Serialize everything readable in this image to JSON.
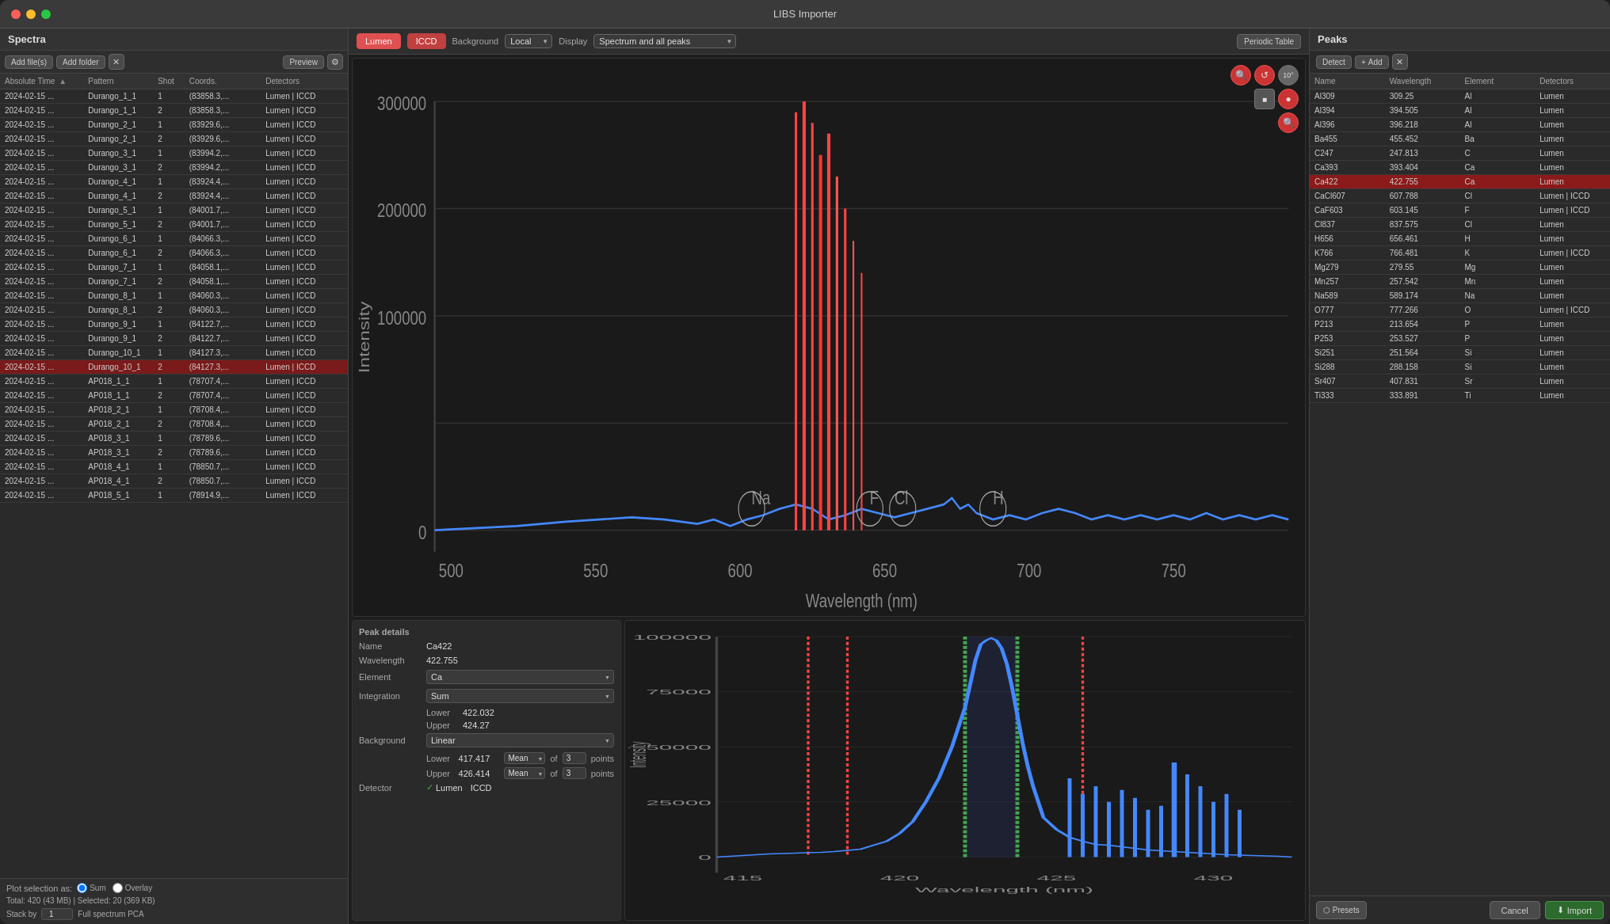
{
  "window": {
    "title": "LIBS Importer",
    "traffic_lights": [
      "close",
      "minimize",
      "maximize"
    ]
  },
  "spectra_panel": {
    "title": "Spectra",
    "toolbar": {
      "add_files": "Add file(s)",
      "add_folder": "Add folder",
      "preview": "Preview"
    },
    "columns": [
      {
        "key": "time",
        "label": "Absolute Time",
        "width": "24%"
      },
      {
        "key": "pattern",
        "label": "Pattern",
        "width": "20%"
      },
      {
        "key": "shot",
        "label": "Shot",
        "width": "10%"
      },
      {
        "key": "coords",
        "label": "Coords.",
        "width": "22%"
      },
      {
        "key": "detectors",
        "label": "Detectors",
        "width": "24%"
      }
    ],
    "rows": [
      {
        "time": "2024-02-15 ...",
        "pattern": "Durango_1_1",
        "shot": "1",
        "coords": "(83858.3,...",
        "detectors": "Lumen | ICCD",
        "selected": false
      },
      {
        "time": "2024-02-15 ...",
        "pattern": "Durango_1_1",
        "shot": "2",
        "coords": "(83858.3,...",
        "detectors": "Lumen | ICCD",
        "selected": false
      },
      {
        "time": "2024-02-15 ...",
        "pattern": "Durango_2_1",
        "shot": "1",
        "coords": "(83929.6,...",
        "detectors": "Lumen | ICCD",
        "selected": false
      },
      {
        "time": "2024-02-15 ...",
        "pattern": "Durango_2_1",
        "shot": "2",
        "coords": "(83929.6,...",
        "detectors": "Lumen | ICCD",
        "selected": false
      },
      {
        "time": "2024-02-15 ...",
        "pattern": "Durango_3_1",
        "shot": "1",
        "coords": "(83994.2,...",
        "detectors": "Lumen | ICCD",
        "selected": false
      },
      {
        "time": "2024-02-15 ...",
        "pattern": "Durango_3_1",
        "shot": "2",
        "coords": "(83994.2,...",
        "detectors": "Lumen | ICCD",
        "selected": false
      },
      {
        "time": "2024-02-15 ...",
        "pattern": "Durango_4_1",
        "shot": "1",
        "coords": "(83924.4,...",
        "detectors": "Lumen | ICCD",
        "selected": false
      },
      {
        "time": "2024-02-15 ...",
        "pattern": "Durango_4_1",
        "shot": "2",
        "coords": "(83924.4,...",
        "detectors": "Lumen | ICCD",
        "selected": false
      },
      {
        "time": "2024-02-15 ...",
        "pattern": "Durango_5_1",
        "shot": "1",
        "coords": "(84001.7,...",
        "detectors": "Lumen | ICCD",
        "selected": false
      },
      {
        "time": "2024-02-15 ...",
        "pattern": "Durango_5_1",
        "shot": "2",
        "coords": "(84001.7,...",
        "detectors": "Lumen | ICCD",
        "selected": false
      },
      {
        "time": "2024-02-15 ...",
        "pattern": "Durango_6_1",
        "shot": "1",
        "coords": "(84066.3,...",
        "detectors": "Lumen | ICCD",
        "selected": false
      },
      {
        "time": "2024-02-15 ...",
        "pattern": "Durango_6_1",
        "shot": "2",
        "coords": "(84066.3,...",
        "detectors": "Lumen | ICCD",
        "selected": false
      },
      {
        "time": "2024-02-15 ...",
        "pattern": "Durango_7_1",
        "shot": "1",
        "coords": "(84058.1,...",
        "detectors": "Lumen | ICCD",
        "selected": false
      },
      {
        "time": "2024-02-15 ...",
        "pattern": "Durango_7_1",
        "shot": "2",
        "coords": "(84058.1,...",
        "detectors": "Lumen | ICCD",
        "selected": false
      },
      {
        "time": "2024-02-15 ...",
        "pattern": "Durango_8_1",
        "shot": "1",
        "coords": "(84060.3,...",
        "detectors": "Lumen | ICCD",
        "selected": false
      },
      {
        "time": "2024-02-15 ...",
        "pattern": "Durango_8_1",
        "shot": "2",
        "coords": "(84060.3,...",
        "detectors": "Lumen | ICCD",
        "selected": false
      },
      {
        "time": "2024-02-15 ...",
        "pattern": "Durango_9_1",
        "shot": "1",
        "coords": "(84122.7,...",
        "detectors": "Lumen | ICCD",
        "selected": false
      },
      {
        "time": "2024-02-15 ...",
        "pattern": "Durango_9_1",
        "shot": "2",
        "coords": "(84122.7,...",
        "detectors": "Lumen | ICCD",
        "selected": false
      },
      {
        "time": "2024-02-15 ...",
        "pattern": "Durango_10_1",
        "shot": "1",
        "coords": "(84127.3,...",
        "detectors": "Lumen | ICCD",
        "selected": false
      },
      {
        "time": "2024-02-15 ...",
        "pattern": "Durango_10_1",
        "shot": "2",
        "coords": "(84127.3,...",
        "detectors": "Lumen | ICCD",
        "selected": true
      },
      {
        "time": "2024-02-15 ...",
        "pattern": "AP018_1_1",
        "shot": "1",
        "coords": "(78707.4,...",
        "detectors": "Lumen | ICCD",
        "selected": false
      },
      {
        "time": "2024-02-15 ...",
        "pattern": "AP018_1_1",
        "shot": "2",
        "coords": "(78707.4,...",
        "detectors": "Lumen | ICCD",
        "selected": false
      },
      {
        "time": "2024-02-15 ...",
        "pattern": "AP018_2_1",
        "shot": "1",
        "coords": "(78708.4,...",
        "detectors": "Lumen | ICCD",
        "selected": false
      },
      {
        "time": "2024-02-15 ...",
        "pattern": "AP018_2_1",
        "shot": "2",
        "coords": "(78708.4,...",
        "detectors": "Lumen | ICCD",
        "selected": false
      },
      {
        "time": "2024-02-15 ...",
        "pattern": "AP018_3_1",
        "shot": "1",
        "coords": "(78789.6,...",
        "detectors": "Lumen | ICCD",
        "selected": false
      },
      {
        "time": "2024-02-15 ...",
        "pattern": "AP018_3_1",
        "shot": "2",
        "coords": "(78789.6,...",
        "detectors": "Lumen | ICCD",
        "selected": false
      },
      {
        "time": "2024-02-15 ...",
        "pattern": "AP018_4_1",
        "shot": "1",
        "coords": "(78850.7,...",
        "detectors": "Lumen | ICCD",
        "selected": false
      },
      {
        "time": "2024-02-15 ...",
        "pattern": "AP018_4_1",
        "shot": "2",
        "coords": "(78850.7,...",
        "detectors": "Lumen | ICCD",
        "selected": false
      },
      {
        "time": "2024-02-15 ...",
        "pattern": "AP018_5_1",
        "shot": "1",
        "coords": "(78914.9,...",
        "detectors": "Lumen | ICCD",
        "selected": false
      }
    ],
    "footer": {
      "plot_selection_label": "Plot selection as:",
      "sum_label": "Sum",
      "overlay_label": "Overlay",
      "total_info": "Total: 420 (43 MB) | Selected: 20 (369 KB)",
      "stack_label": "Stack by",
      "stack_value": "1",
      "pca_label": "Full spectrum PCA"
    }
  },
  "center_panel": {
    "detectors": [
      "Lumen",
      "ICCD"
    ],
    "background_label": "Background",
    "background_value": "Local",
    "display_label": "Display",
    "display_value": "Spectrum and all peaks",
    "periodic_table_btn": "Periodic Table",
    "chart_upper": {
      "y_axis_values": [
        "300000",
        "200000",
        "100000",
        "0"
      ],
      "x_axis_values": [
        "500",
        "550",
        "600",
        "650",
        "700",
        "750"
      ],
      "x_label": "Wavelength (nm)",
      "y_label": "Intensity",
      "peak_labels": [
        "Na",
        "F",
        "Cl",
        "H"
      ]
    },
    "chart_lower": {
      "y_axis_values": [
        "100000",
        "75000",
        "50000",
        "25000",
        "0"
      ],
      "x_axis_values": [
        "415",
        "420",
        "425",
        "430"
      ],
      "x_label": "Wavelength (nm)",
      "y_label": "Intensity"
    }
  },
  "peak_details": {
    "title": "Peak details",
    "name_label": "Name",
    "name_value": "Ca422",
    "wavelength_label": "Wavelength",
    "wavelength_value": "422.755",
    "element_label": "Element",
    "element_value": "Ca",
    "integration_label": "Integration",
    "integration_value": "Sum",
    "lower_label": "Lower",
    "lower_value": "422.032",
    "upper_label": "Upper",
    "upper_value": "424.27",
    "background_label": "Background",
    "background_value": "Linear",
    "bg_lower_label": "Lower",
    "bg_lower_value": "417.417",
    "bg_lower_mean": "Mean",
    "bg_lower_of": "of",
    "bg_lower_points": "3",
    "bg_lower_points_label": "points",
    "bg_upper_label": "Upper",
    "bg_upper_value": "426.414",
    "bg_upper_mean": "Mean",
    "bg_upper_of": "of",
    "bg_upper_points": "3",
    "bg_upper_points_label": "points",
    "detector_label": "Detector",
    "detector_lumen": "Lumen",
    "detector_iccd": "ICCD"
  },
  "peaks_panel": {
    "title": "Peaks",
    "detect_btn": "Detect",
    "add_btn": "+ Add",
    "columns": [
      {
        "key": "name",
        "label": "Name"
      },
      {
        "key": "wavelength",
        "label": "Wavelength"
      },
      {
        "key": "element",
        "label": "Element"
      },
      {
        "key": "detectors",
        "label": "Detectors"
      }
    ],
    "rows": [
      {
        "name": "Al309",
        "wavelength": "309.25",
        "element": "Al",
        "detectors": "Lumen",
        "selected": false
      },
      {
        "name": "Al394",
        "wavelength": "394.505",
        "element": "Al",
        "detectors": "Lumen",
        "selected": false
      },
      {
        "name": "Al396",
        "wavelength": "396.218",
        "element": "Al",
        "detectors": "Lumen",
        "selected": false
      },
      {
        "name": "Ba455",
        "wavelength": "455.452",
        "element": "Ba",
        "detectors": "Lumen",
        "selected": false
      },
      {
        "name": "C247",
        "wavelength": "247.813",
        "element": "C",
        "detectors": "Lumen",
        "selected": false
      },
      {
        "name": "Ca393",
        "wavelength": "393.404",
        "element": "Ca",
        "detectors": "Lumen",
        "selected": false
      },
      {
        "name": "Ca422",
        "wavelength": "422.755",
        "element": "Ca",
        "detectors": "Lumen",
        "selected": true
      },
      {
        "name": "CaCl607",
        "wavelength": "607.788",
        "element": "Cl",
        "detectors": "Lumen | ICCD",
        "selected": false
      },
      {
        "name": "CaF603",
        "wavelength": "603.145",
        "element": "F",
        "detectors": "Lumen | ICCD",
        "selected": false
      },
      {
        "name": "Cl837",
        "wavelength": "837.575",
        "element": "Cl",
        "detectors": "Lumen",
        "selected": false
      },
      {
        "name": "H656",
        "wavelength": "656.461",
        "element": "H",
        "detectors": "Lumen",
        "selected": false
      },
      {
        "name": "K766",
        "wavelength": "766.481",
        "element": "K",
        "detectors": "Lumen | ICCD",
        "selected": false
      },
      {
        "name": "Mg279",
        "wavelength": "279.55",
        "element": "Mg",
        "detectors": "Lumen",
        "selected": false
      },
      {
        "name": "Mn257",
        "wavelength": "257.542",
        "element": "Mn",
        "detectors": "Lumen",
        "selected": false
      },
      {
        "name": "Na589",
        "wavelength": "589.174",
        "element": "Na",
        "detectors": "Lumen",
        "selected": false
      },
      {
        "name": "O777",
        "wavelength": "777.266",
        "element": "O",
        "detectors": "Lumen | ICCD",
        "selected": false
      },
      {
        "name": "P213",
        "wavelength": "213.654",
        "element": "P",
        "detectors": "Lumen",
        "selected": false
      },
      {
        "name": "P253",
        "wavelength": "253.527",
        "element": "P",
        "detectors": "Lumen",
        "selected": false
      },
      {
        "name": "Si251",
        "wavelength": "251.564",
        "element": "Si",
        "detectors": "Lumen",
        "selected": false
      },
      {
        "name": "Si288",
        "wavelength": "288.158",
        "element": "Si",
        "detectors": "Lumen",
        "selected": false
      },
      {
        "name": "Sr407",
        "wavelength": "407.831",
        "element": "Sr",
        "detectors": "Lumen",
        "selected": false
      },
      {
        "name": "Ti333",
        "wavelength": "333.891",
        "element": "Ti",
        "detectors": "Lumen",
        "selected": false
      }
    ],
    "footer": {
      "presets_btn": "⬡ Presets",
      "cancel_btn": "Cancel",
      "import_btn": "⬇ Import"
    }
  }
}
